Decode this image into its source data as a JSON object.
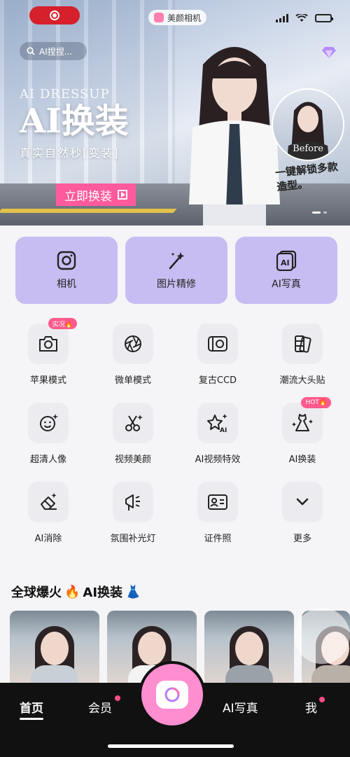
{
  "banner": {
    "app_name": "美颜相机",
    "search_placeholder": "AI捏捏...",
    "title_en": "AI DRESSUP",
    "title_big": "AI换装",
    "subtitle": "真实自然秒[变装]",
    "cta_label": "立即换装",
    "before_label": "Before",
    "slogan": "一键解锁多款造型。",
    "accent_color": "#ff5a9c"
  },
  "big_cards": [
    {
      "label": "相机",
      "icon": "camera-icon"
    },
    {
      "label": "图片精修",
      "icon": "magic-wand-icon"
    },
    {
      "label": "AI写真",
      "icon": "ai-photo-icon"
    }
  ],
  "tools": [
    {
      "label": "苹果模式",
      "icon": "camera-icon",
      "badge": "实况🔥"
    },
    {
      "label": "微单模式",
      "icon": "aperture-icon",
      "badge": ""
    },
    {
      "label": "复古CCD",
      "icon": "ccd-camera-icon",
      "badge": ""
    },
    {
      "label": "潮流大头贴",
      "icon": "photo-strip-icon",
      "badge": ""
    },
    {
      "label": "超清人像",
      "icon": "smile-face-icon",
      "badge": ""
    },
    {
      "label": "视频美颜",
      "icon": "scissors-icon",
      "badge": ""
    },
    {
      "label": "AI视频特效",
      "icon": "ai-sparkle-icon",
      "badge": ""
    },
    {
      "label": "AI换装",
      "icon": "dress-icon",
      "badge": "HOT🔥"
    },
    {
      "label": "AI消除",
      "icon": "eraser-icon",
      "badge": ""
    },
    {
      "label": "氛围补光灯",
      "icon": "light-icon",
      "badge": ""
    },
    {
      "label": "证件照",
      "icon": "id-card-icon",
      "badge": ""
    },
    {
      "label": "更多",
      "icon": "chevron-down-icon",
      "badge": ""
    }
  ],
  "section": {
    "title": "全球爆火",
    "title_ai": "AI换装"
  },
  "tabbar": {
    "home": "首页",
    "member": "会员",
    "ai_photo": "AI写真",
    "me": "我"
  }
}
